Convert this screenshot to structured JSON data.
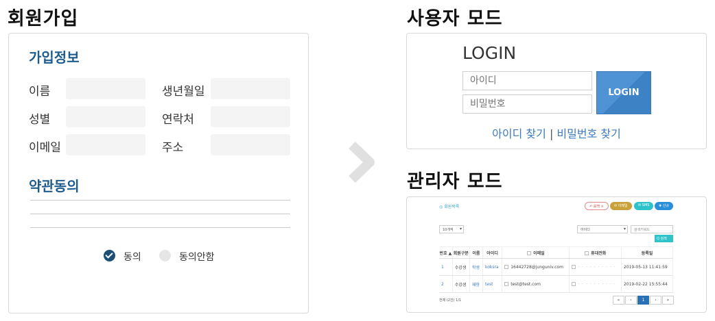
{
  "signup": {
    "title": "회원가입",
    "section_info": "가입정보",
    "fields": [
      {
        "label": "이름"
      },
      {
        "label": "생년월일"
      },
      {
        "label": "성별"
      },
      {
        "label": "연락처"
      },
      {
        "label": "이메일"
      },
      {
        "label": "주소"
      }
    ],
    "section_terms": "약관동의",
    "agree_label": "동의",
    "disagree_label": "동의안함"
  },
  "user_mode": {
    "title": "사용자 모드",
    "login_heading": "LOGIN",
    "id_placeholder": "아이디",
    "pw_placeholder": "비밀번호",
    "login_button": "LOGIN",
    "find_id": "아이디 찾기",
    "separator": "|",
    "find_pw": "비밀번호 찾기"
  },
  "admin_mode": {
    "title": "관리자 모드",
    "panel_title": "◎ 회원목록",
    "buttons": [
      "↶ 롤백 ×",
      "✉ 이메일",
      "✉ SMS",
      "✚ 신규"
    ],
    "page_size": "10개씩",
    "search_field": "아이디",
    "search_placeholder": "검색키워드",
    "search_button": "Q 검색",
    "columns": [
      "번호 ▲",
      "회원구분",
      "이름",
      "아이디",
      "이메일",
      "휴대전화",
      "등록일"
    ],
    "rows": [
      {
        "no": "1",
        "type": "수강생",
        "name": "학생",
        "id": "koksra",
        "email": "16442728@junguniv.com",
        "phone": "· · · · · · · · · ·",
        "date": "2019-05-13 11:41:59"
      },
      {
        "no": "2",
        "type": "수강생",
        "name": "재형",
        "id": "test",
        "email": "test@test.com",
        "phone": "· · · · · · · · · ·",
        "date": "2019-02-22 15:55:44"
      }
    ],
    "total": "전체 (2건) 1/1",
    "pagination": [
      "«",
      "‹",
      "1",
      "›",
      "»"
    ]
  },
  "colors": {
    "accent": "#1e5b8e",
    "link": "#3b7abf",
    "login_button": "#4f93d4"
  }
}
